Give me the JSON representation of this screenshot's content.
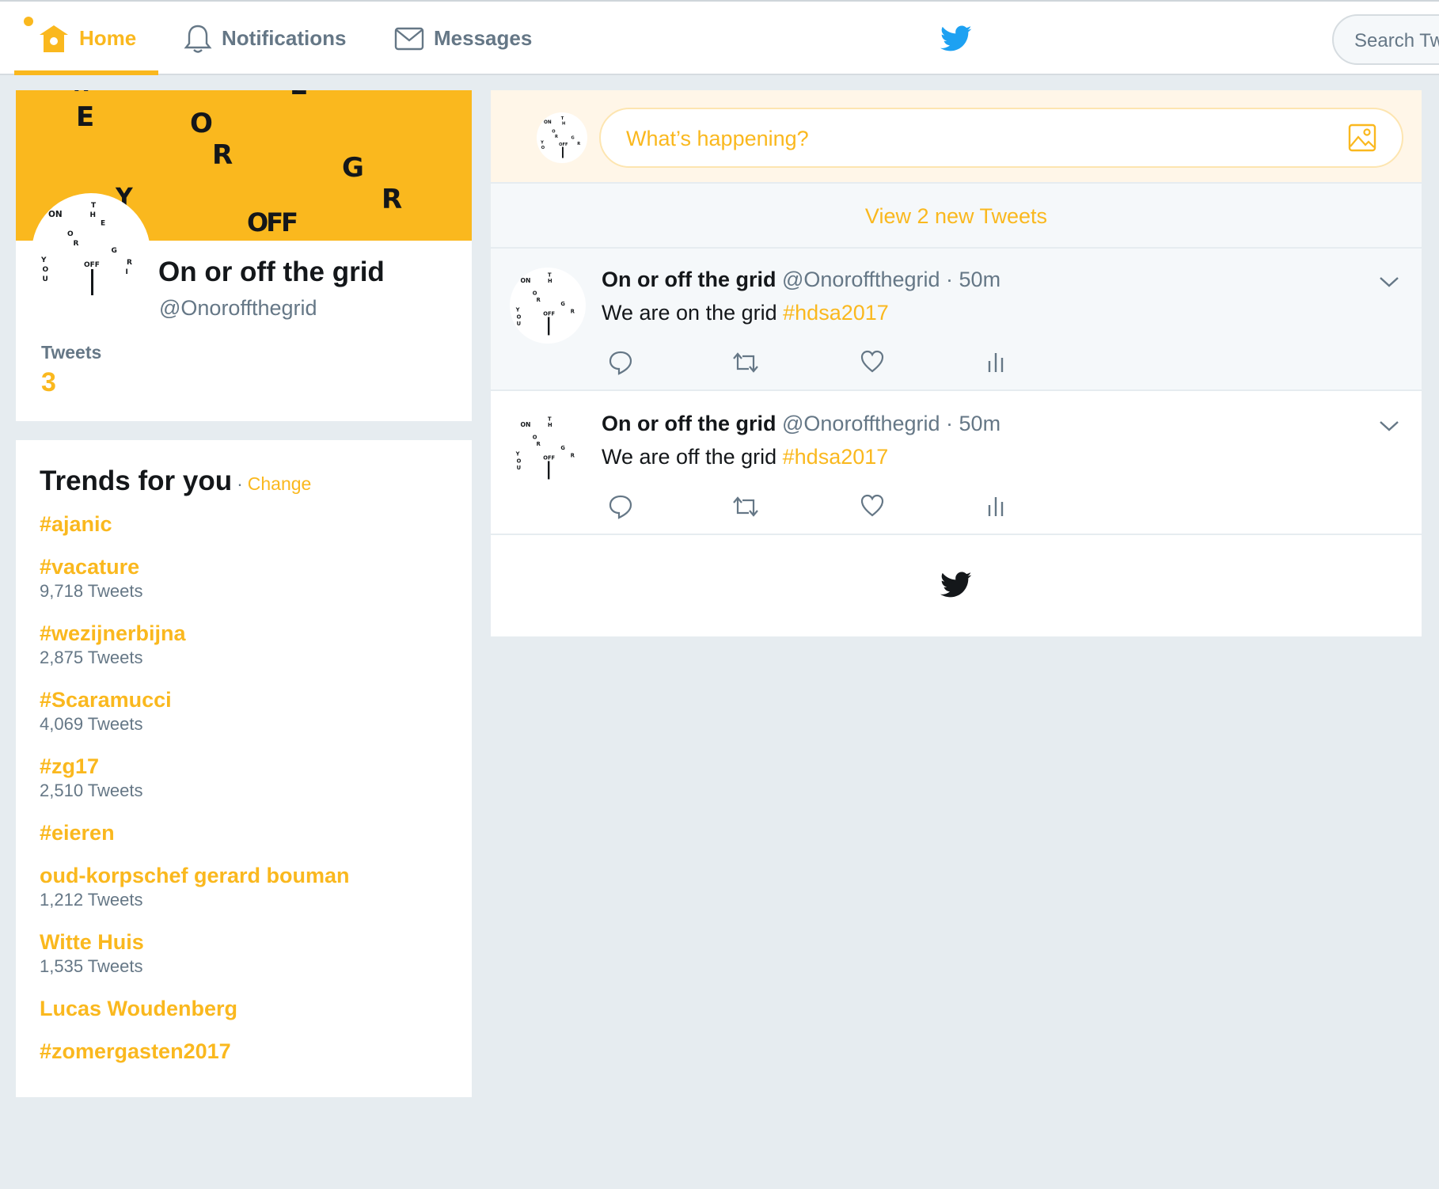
{
  "nav": {
    "home_label": "Home",
    "notifications_label": "Notifications",
    "messages_label": "Messages",
    "search_placeholder": "Search Tw"
  },
  "profile": {
    "name": "On or off the grid",
    "handle": "@Onoroffthegrid",
    "tweets_label": "Tweets",
    "tweets_count": "3"
  },
  "banner_letters": [
    "E",
    "O",
    "R",
    "G",
    "R",
    "OFF",
    "L",
    "Y"
  ],
  "trends": {
    "title": "Trends for you",
    "separator": "·",
    "change_label": "Change",
    "items": [
      {
        "name": "#ajanic",
        "count": ""
      },
      {
        "name": "#vacature",
        "count": "9,718 Tweets"
      },
      {
        "name": "#wezijnerbijna",
        "count": "2,875 Tweets"
      },
      {
        "name": "#Scaramucci",
        "count": "4,069 Tweets"
      },
      {
        "name": "#zg17",
        "count": "2,510 Tweets"
      },
      {
        "name": "#eieren",
        "count": ""
      },
      {
        "name": "oud-korpschef gerard bouman",
        "count": "1,212 Tweets"
      },
      {
        "name": "Witte Huis",
        "count": "1,535 Tweets"
      },
      {
        "name": "Lucas Woudenberg",
        "count": ""
      },
      {
        "name": "#zomergasten2017",
        "count": ""
      }
    ]
  },
  "composer": {
    "placeholder": "What’s happening?"
  },
  "timeline": {
    "new_tweets_label": "View 2 new Tweets",
    "tweets": [
      {
        "name": "On or off the grid",
        "handle": "@Onoroffthegrid",
        "time": "· 50m",
        "text": "We are on the grid ",
        "hashtag": "#hdsa2017"
      },
      {
        "name": "On or off the grid",
        "handle": "@Onoroffthegrid",
        "time": "· 50m",
        "text": "We are off the grid ",
        "hashtag": "#hdsa2017"
      }
    ]
  },
  "colors": {
    "accent": "#fab81e",
    "twitter_blue": "#1da1f2",
    "muted": "#657786",
    "background": "#e6ecf0"
  }
}
